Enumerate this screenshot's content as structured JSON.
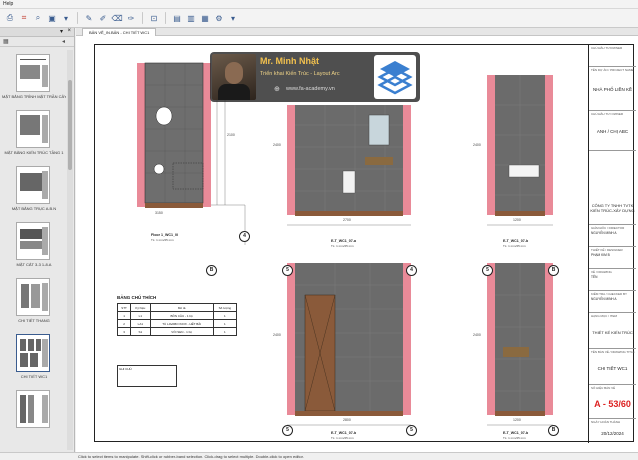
{
  "menu": {
    "help": "Help"
  },
  "toolbar": {
    "icons": [
      "print-icon",
      "crop-icon",
      "zoom-icon",
      "snapshot-icon",
      "dropdown-icon",
      "pen-icon",
      "highlight-icon",
      "eraser-icon",
      "markup-icon",
      "fit-icon",
      "page-icon",
      "document-icon",
      "save-icon",
      "settings-icon",
      "dropdown-icon"
    ]
  },
  "sidebar": {
    "thumbnails": [
      {
        "label": "MẶT BẰNG TRÌNH MẶT TRẦN CÂY 1"
      },
      {
        "label": "MẶT BẰNG KIẾN TRÚC TẦNG 1"
      },
      {
        "label": "MẶT BẰNG TRỤC A.B.N"
      },
      {
        "label": "MẶT CẮT 3-3 1-8.A"
      },
      {
        "label": "CHI TIẾT THANG"
      },
      {
        "label": "CHI TIẾT WC1"
      },
      {
        "label": ""
      }
    ]
  },
  "tab": {
    "label": "BẢN VẼ_IN.BẢN - CHI TIẾT WC1"
  },
  "overlay": {
    "name": "Mr. Minh Nhật",
    "subtitle": "Triển khai Kiến Trúc - Layout Arc",
    "website": "www.fa-academy.vn"
  },
  "drawing": {
    "views": [
      {
        "label": "Floor 1_WC1_0l",
        "scale": "TL: 1 mm/25 mm"
      },
      {
        "label": "E-T_WC1_07-a",
        "scale": "TL: 1 mm/25 mm"
      },
      {
        "label": "E-T_WC1_07-b",
        "scale": "TL: 1 mm/25 mm"
      },
      {
        "label": "E-T_WC1_07-b",
        "scale": "TL: 1 mm/25 mm"
      },
      {
        "label": "E-T_WC1_07-b",
        "scale": "TL: 1 mm/25 mm"
      }
    ],
    "grid_marks": [
      "4",
      "B",
      "5",
      "4",
      "5",
      "B",
      "5",
      "5",
      "B"
    ],
    "dims": [
      "2400",
      "2400",
      "2400",
      "2400",
      "2700",
      "1200",
      "2100",
      "2100",
      "2800",
      "1200",
      "3150"
    ],
    "legend_title": "BẢNG CHÚ THÍCH",
    "legend_rows": [
      [
        "STT",
        "Ký hiệu",
        "Mô tả",
        "Số lượng"
      ],
      [
        "1",
        "L1",
        "BỒN CẦU - 1 bộ",
        "1"
      ],
      [
        "2",
        "LA1",
        "TỦ LAVABO INOX - HẾT BÃI",
        "1"
      ],
      [
        "3",
        "S1",
        "VÒI SEN - 1 bộ",
        "1"
      ]
    ],
    "note": "GHI CHÚ"
  },
  "title_block": {
    "blocks": [
      {
        "label": "CHỦ ĐẦU TƯ/OWNER",
        "value": ""
      },
      {
        "label": "TÊN DỰ ÁN / PROJECT NAME",
        "value": "NHÀ PHỐ LIỀN KỀ"
      },
      {
        "label": "CHỦ ĐẦU TƯ/ OWNER",
        "value": "ANH / CHỊ ABC"
      },
      {
        "label": "",
        "value": "CÔNG TY TNHH TVTK KIẾN TRÚC-XÂY DỰNG"
      },
      {
        "label": "GIÁM ĐỐC / DIRECTOR",
        "value": "NGUYỄN MINH A"
      },
      {
        "label": "THIẾT KẾ / DESIGNER",
        "value": "PHẠM KIM B"
      },
      {
        "label": "VẼ / DRAWING",
        "value": "TÊN"
      },
      {
        "label": "KIỂM TRA / CHECKED BY",
        "value": "NGUYỄN MINH A"
      },
      {
        "label": "HẠNG MỤC / ITEM",
        "value": "THIẾT KẾ KIẾN TRÚC"
      },
      {
        "label": "TÊN BẢN VẼ / DRAWING TITLE",
        "value": "CHI TIẾT WC1"
      },
      {
        "label": "SỐ HIỆU BẢN VẼ",
        "value": "A - 53/60"
      },
      {
        "label": "NGÀY HOÀN THÀNH",
        "value": "20/12/2024"
      }
    ]
  },
  "status": "Click to select items to manipulate. Shift-click or rubber-band selection. Click-drag to select multiple. Double-click to open editor.",
  "colors": {
    "accent": "#3a5c8f",
    "pink": "#e98a98",
    "wall": "#6e6e6e",
    "floor": "#8a5a3a",
    "red": "#d22222"
  }
}
